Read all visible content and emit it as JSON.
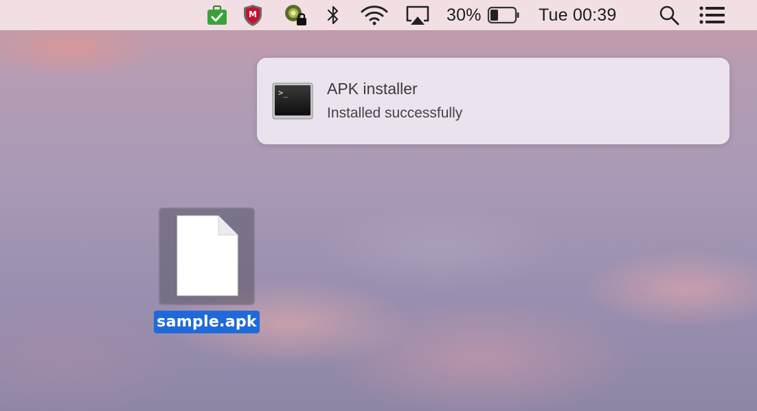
{
  "menubar": {
    "battery_percent": "30%",
    "battery_level": 0.3,
    "clock": "Tue 00:39",
    "icons": [
      "briefcase-check-icon",
      "mcafee-shield-icon",
      "vpn-lock-icon",
      "bluetooth-icon",
      "wifi-icon",
      "airplay-icon",
      "battery-icon",
      "spotlight-search-icon",
      "notification-center-icon"
    ],
    "colors": {
      "briefcase": "#3aa13a",
      "mcafee": "#c8102e"
    }
  },
  "notification": {
    "app_icon": "terminal-icon",
    "terminal_prompt": ">_",
    "title": "APK installer",
    "body": "Installed successfully"
  },
  "desktop": {
    "file": {
      "icon": "document-icon",
      "name": "sample.apk",
      "selected": true,
      "selection_color": "#1f6ad8"
    }
  }
}
